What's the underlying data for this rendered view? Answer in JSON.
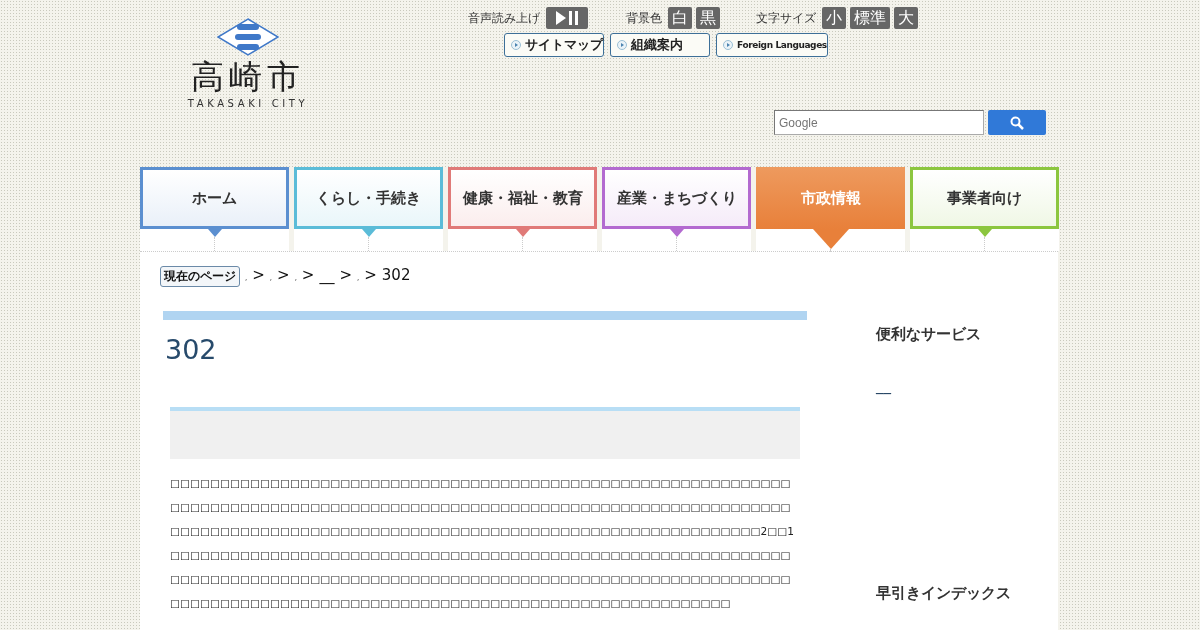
{
  "logo": {
    "name": "高崎市",
    "subtitle": "TAKASAKI CITY"
  },
  "tools": {
    "speech_label": "音声読み上げ",
    "background_label": "背景色",
    "background_options": [
      "白",
      "黒"
    ],
    "textsize_label": "文字サイズ",
    "textsize_options": [
      "小",
      "標準",
      "大"
    ]
  },
  "links": [
    {
      "label": "サイトマップ",
      "kind": "jp"
    },
    {
      "label": "組織案内",
      "kind": "jp"
    },
    {
      "label": "Foreign Languages",
      "kind": "latin"
    }
  ],
  "search": {
    "placeholder": "Google"
  },
  "tabs": [
    {
      "label": "ホーム",
      "color": "#5b8fd0",
      "selected": false
    },
    {
      "label": "くらし・手続き",
      "color": "#5bbcd8",
      "selected": false
    },
    {
      "label": "健康・福祉・教育",
      "color": "#e07a78",
      "selected": false
    },
    {
      "label": "産業・まちづくり",
      "color": "#b36ad0",
      "selected": false
    },
    {
      "label": "市政情報",
      "color": "#e8803a",
      "selected": true
    },
    {
      "label": "事業者向け",
      "color": "#8cc63f",
      "selected": false
    }
  ],
  "breadcrumb": {
    "badge": "現在のページ",
    "separator": ">",
    "items": [
      ",",
      ",",
      ",",
      "__",
      ",",
      "302"
    ]
  },
  "page_title": "302",
  "body": "□□□□□□□□□□□□□□□□□□□□□□□□□□□□□□□□□□□□□□□□□□□□□□□□□□□□□□□□□□□□□□□□□□□□□□□□□□□□□□□□□□□□□□□□□□□□□□□□□□□□□□□□□□□□□□□□□□□□□□□□□□□□□□□□□□□□□□□□□□□□□□□□□□□□□□□□□□□□□□□□□□□□□□□□□□□□□□□□□□□□□□□2□□1□□□□□□□□□□□□□□□□□□□□□□□□□□□□□□□□□□□□□□□□□□□□□□□□□□□□□□□□□□□□□□□□□□□□□□□□□□□□□□□□□□□□□□□□□□□□□□□□□□□□□□□□□□□□□□□□□□□□□□□□□□□□□□□□□□□□□□□□□□□□□□□□□□□□□□□□□□□□□□□□□□□□□□□□□□□□□□□□□□□□",
  "sidebar": [
    {
      "heading": "便利なサービス",
      "link": "__"
    },
    {
      "heading": "早引きインデックス"
    }
  ]
}
